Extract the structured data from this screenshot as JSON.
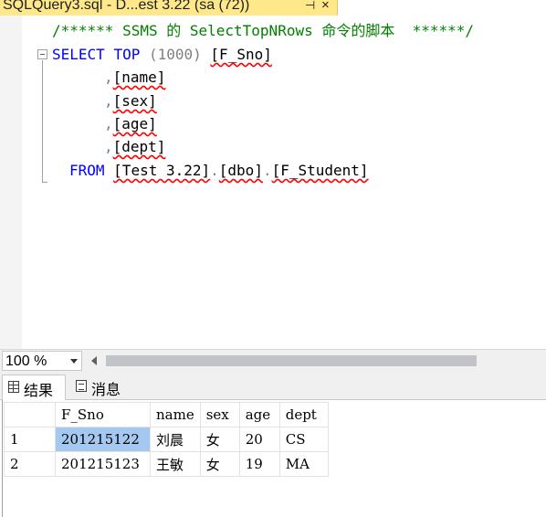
{
  "document_tab": {
    "title": "SQLQuery3.sql - D...est 3.22 (sa (72))",
    "pin_glyph": "⊣",
    "close_glyph": "×"
  },
  "editor": {
    "comment": "/****** SSMS 的 SelectTopNRows 命令的脚本  ******/",
    "select_kw": "SELECT",
    "top_kw": "TOP",
    "top_value": "(1000)",
    "columns": [
      "[F_Sno]",
      "[name]",
      "[sex]",
      "[age]",
      "[dept]"
    ],
    "comma": ",",
    "from_kw": "FROM",
    "from_table": {
      "db": "[Test 3.22]",
      "dot": ".",
      "schema": "[dbo]",
      "table": "[F_Student]"
    }
  },
  "zoom": {
    "value": "100 %"
  },
  "results_tabs": {
    "results_label": "结果",
    "messages_label": "消息",
    "results_icon": "grid-icon",
    "messages_icon": "message-icon"
  },
  "grid": {
    "headers": [
      "",
      "F_Sno",
      "name",
      "sex",
      "age",
      "dept"
    ],
    "rows": [
      {
        "num": "1",
        "F_Sno": "201215122",
        "name": "刘晨",
        "sex": "女",
        "age": "20",
        "dept": "CS"
      },
      {
        "num": "2",
        "F_Sno": "201215123",
        "name": "王敏",
        "sex": "女",
        "age": "19",
        "dept": "MA"
      }
    ]
  },
  "colors": {
    "tab_active": "#ffe88a",
    "keyword": "#0000ff",
    "comment": "#008000",
    "squiggle": "#ff0000",
    "selected_cell": "#a4c8ef"
  }
}
